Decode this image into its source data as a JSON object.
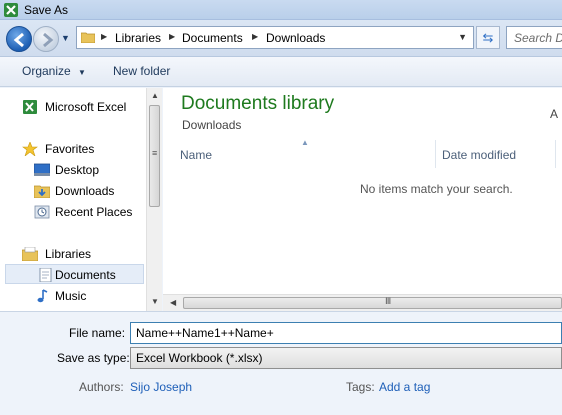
{
  "window": {
    "title": "Save As"
  },
  "address": {
    "crumbs": [
      "Libraries",
      "Documents",
      "Downloads"
    ],
    "search_placeholder": "Search D"
  },
  "toolbar": {
    "organize": "Organize",
    "new_folder": "New folder"
  },
  "nav": {
    "items": [
      {
        "label": "Microsoft Excel",
        "icon": "excel-icon"
      },
      {
        "label": "Favorites",
        "icon": "star-icon"
      },
      {
        "label": "Desktop",
        "icon": "desktop-icon"
      },
      {
        "label": "Downloads",
        "icon": "downloads-folder-icon"
      },
      {
        "label": "Recent Places",
        "icon": "recent-places-icon"
      },
      {
        "label": "Libraries",
        "icon": "libraries-icon"
      },
      {
        "label": "Documents",
        "icon": "documents-icon",
        "selected": true
      },
      {
        "label": "Music",
        "icon": "music-icon"
      }
    ]
  },
  "content": {
    "library_title": "Documents library",
    "library_subtitle": "Downloads",
    "arrange_fragment": "A",
    "columns": {
      "name": "Name",
      "date_modified": "Date modified"
    },
    "empty_message": "No items match your search."
  },
  "form": {
    "file_name_label": "File name:",
    "file_name_value": "Name++Name1++Name+",
    "save_type_label": "Save as type:",
    "save_type_value": "Excel Workbook (*.xlsx)",
    "authors_label": "Authors:",
    "authors_value": "Sijo Joseph",
    "tags_label": "Tags:",
    "tags_value": "Add a tag"
  },
  "colors": {
    "library_green": "#1e7a1e",
    "link_blue": "#1e5fb8",
    "selection": "#e5edf8"
  }
}
